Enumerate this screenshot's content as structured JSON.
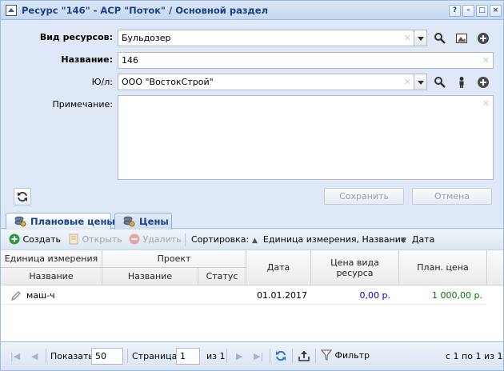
{
  "window": {
    "title": "Ресурс \"146\" - АСР \"Поток\" / Основной раздел"
  },
  "form": {
    "resource_type": {
      "label": "Вид ресурсов:",
      "value": "Бульдозер"
    },
    "name": {
      "label": "Название:",
      "value": "146"
    },
    "legal_entity": {
      "label": "Ю/л:",
      "value": "ООО \"ВостокСтрой\""
    },
    "note": {
      "label": "Примечание:",
      "value": ""
    },
    "save_label": "Сохранить",
    "cancel_label": "Отмена"
  },
  "tabs": [
    {
      "label": "Плановые цены",
      "active": true
    },
    {
      "label": "Цены",
      "active": false
    }
  ],
  "grid_toolbar": {
    "create": "Создать",
    "open": "Открыть",
    "delete": "Удалить",
    "sort_label": "Сортировка:",
    "sort_1": "Единица измерения, Название",
    "sort_2": "Дата"
  },
  "grid": {
    "group_unit": "Единица измерения",
    "group_project": "Проект",
    "col_unit_name": "Название",
    "col_project_name": "Название",
    "col_status": "Статус",
    "col_date": "Дата",
    "col_price_type": "Цена вида ресурса",
    "col_plan_price": "План. цена",
    "rows": [
      {
        "unit": "маш-ч",
        "project": "",
        "status": "",
        "date": "01.01.2017",
        "price_type": "0,00 р.",
        "plan_price": "1 000,00 р."
      }
    ]
  },
  "paging": {
    "show_label": "Показать",
    "page_size": "50",
    "page_label": "Страница",
    "page": "1",
    "of_label": "из 1",
    "filter_label": "Фильтр",
    "summary": "с 1 по 1 из 1"
  },
  "colors": {
    "accent": "#15428b",
    "price_blue": "#0000cc",
    "price_green": "#007a00"
  }
}
